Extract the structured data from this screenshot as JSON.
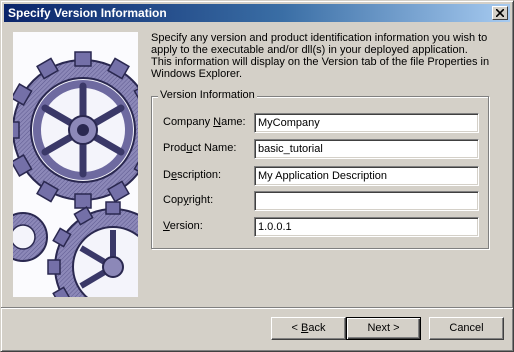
{
  "window": {
    "title": "Specify Version Information"
  },
  "intro_text": "Specify any version and product identification information you wish to apply to the executable and/or dll(s) in your deployed application.  This information will display on the Version tab of the file Properties in Windows Explorer.",
  "version_group": {
    "legend": "Version Information",
    "fields": [
      {
        "label_pre": "Company ",
        "label_key": "N",
        "label_post": "ame:",
        "value": "MyCompany"
      },
      {
        "label_pre": "Prod",
        "label_key": "u",
        "label_post": "ct Name:",
        "value": "basic_tutorial"
      },
      {
        "label_pre": "D",
        "label_key": "e",
        "label_post": "scription:",
        "value": "My Application Description"
      },
      {
        "label_pre": "Cop",
        "label_key": "y",
        "label_post": "right:",
        "value": ""
      },
      {
        "label_pre": "",
        "label_key": "V",
        "label_post": "ersion:",
        "value": "1.0.0.1"
      }
    ]
  },
  "buttons": {
    "back": {
      "pre": "< ",
      "key": "B",
      "post": "ack"
    },
    "next": "Next >",
    "cancel": "Cancel"
  }
}
